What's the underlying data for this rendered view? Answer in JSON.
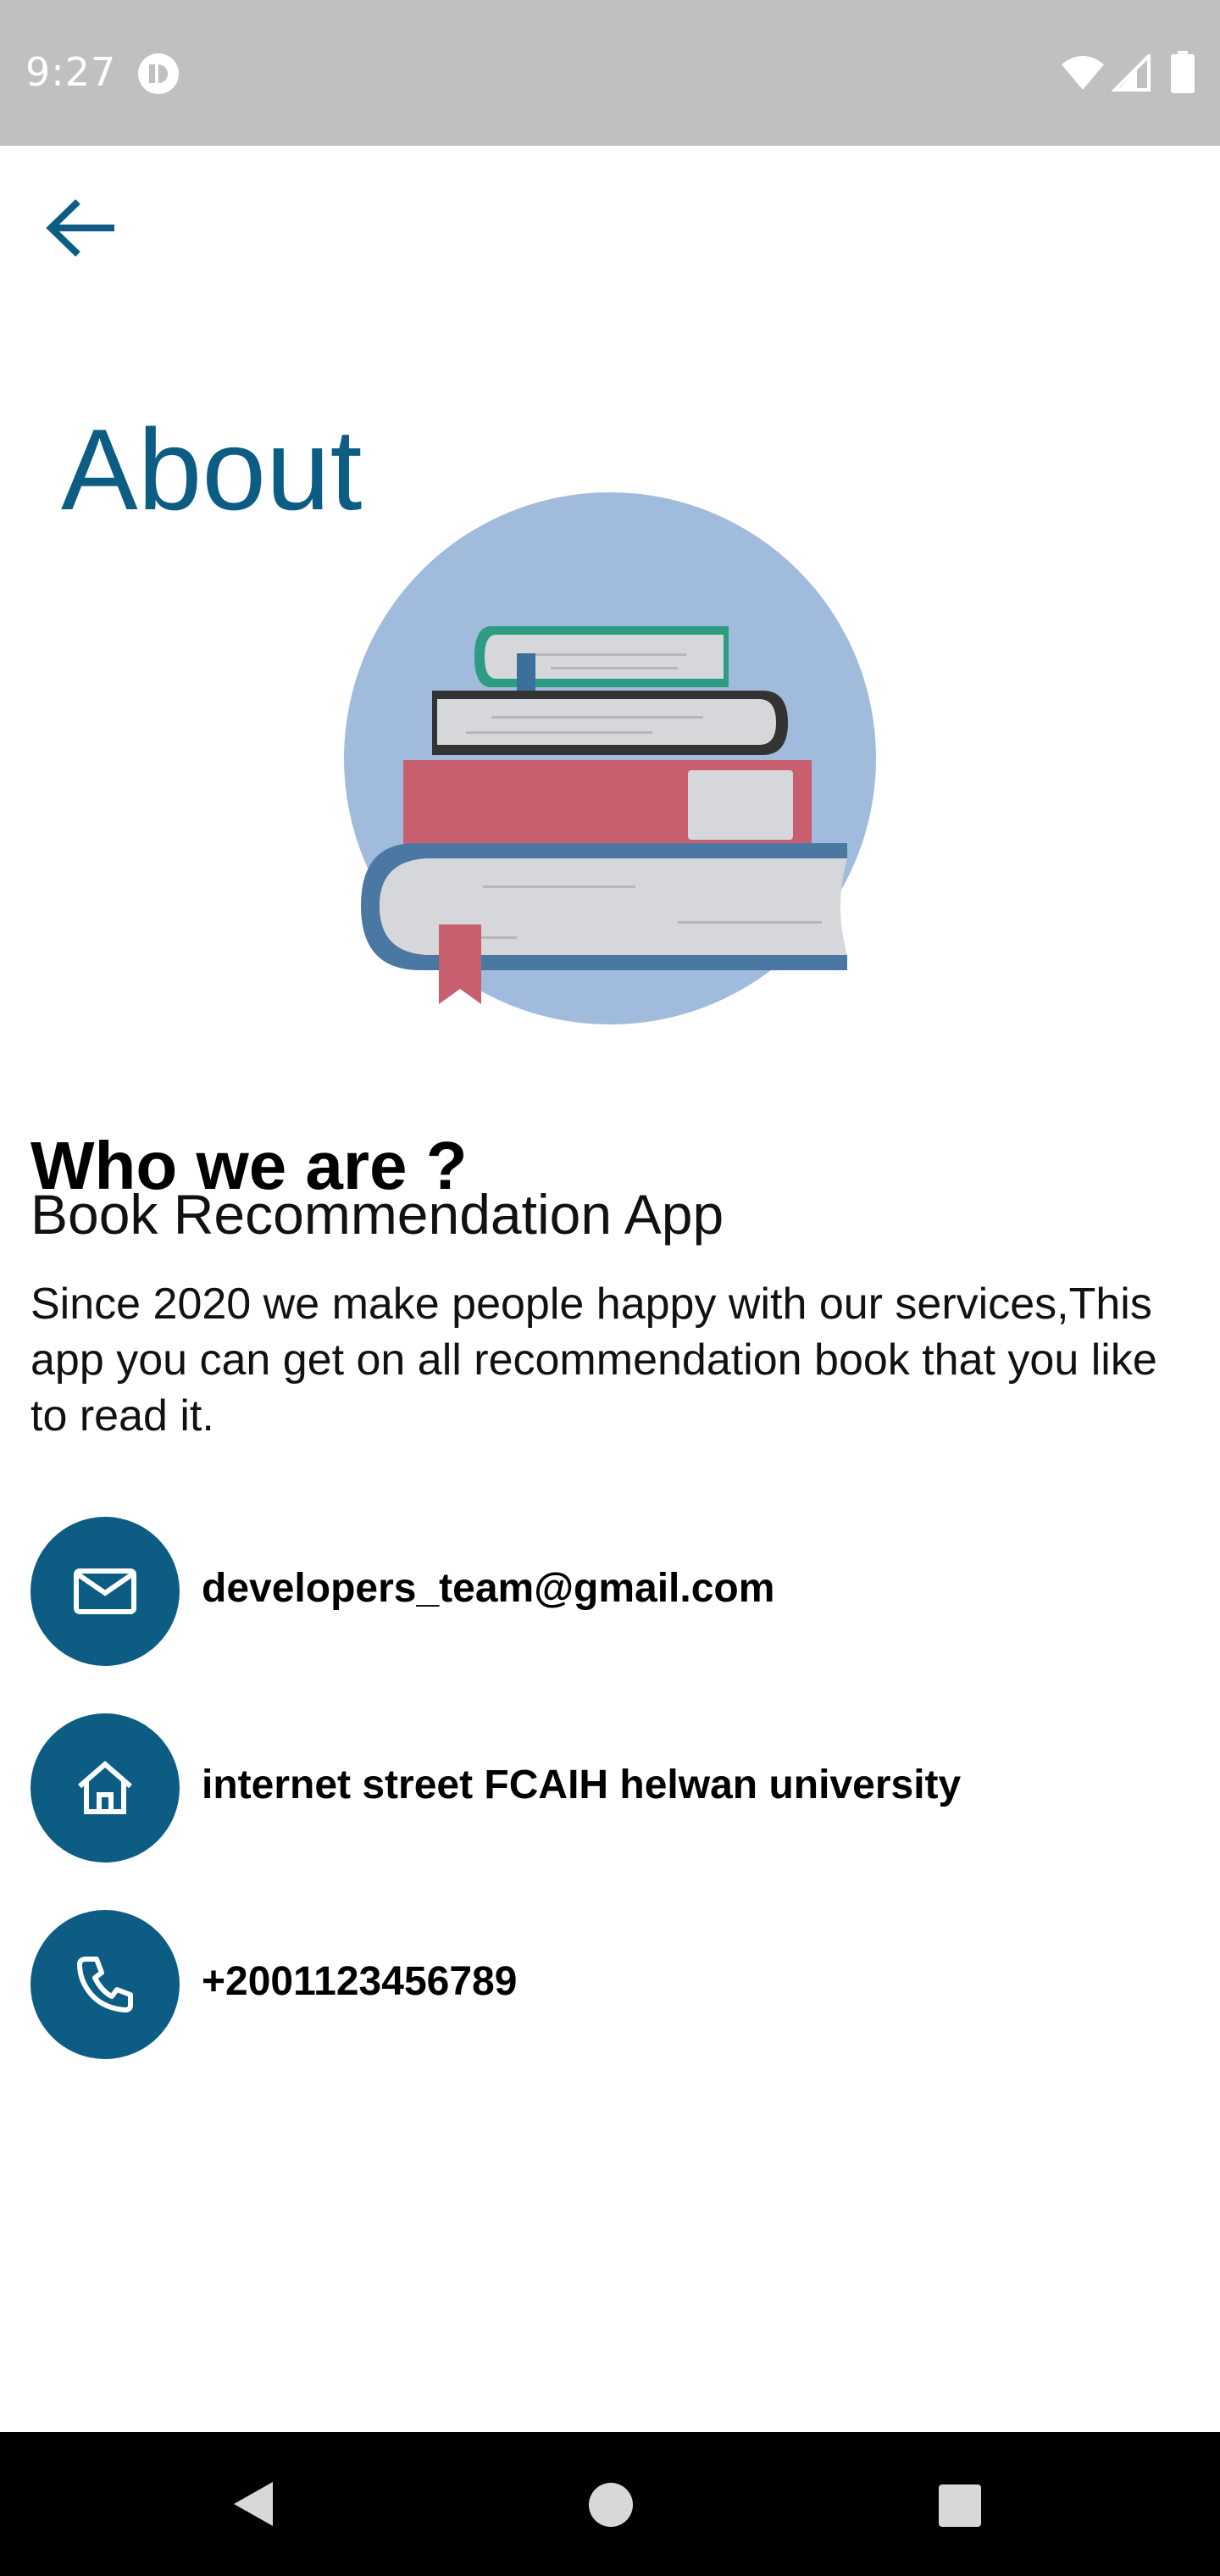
{
  "status_bar": {
    "time": "9:27",
    "icons": [
      "app-notification-icon",
      "wifi-icon",
      "signal-icon",
      "battery-icon"
    ]
  },
  "header": {
    "back_icon": "arrow-left-icon",
    "title": "About"
  },
  "hero": {
    "icon": "book-stack-illustration"
  },
  "content": {
    "heading": "Who we are ?",
    "app_name": "Book Recommendation App",
    "description": "Since 2020 we make people happy with our services,This app you can get on all recommendation book that you like to read it."
  },
  "contacts": [
    {
      "icon": "email-icon",
      "text": "developers_team@gmail.com"
    },
    {
      "icon": "home-icon",
      "text": "internet street FCAIH helwan university"
    },
    {
      "icon": "phone-icon",
      "text": "+2001123456789"
    }
  ],
  "colors": {
    "accent": "#0c5c84",
    "status_bar": "#c0c0c0",
    "nav_bar": "#000000"
  },
  "nav_bar": {
    "buttons": [
      "back",
      "home",
      "recents"
    ]
  }
}
